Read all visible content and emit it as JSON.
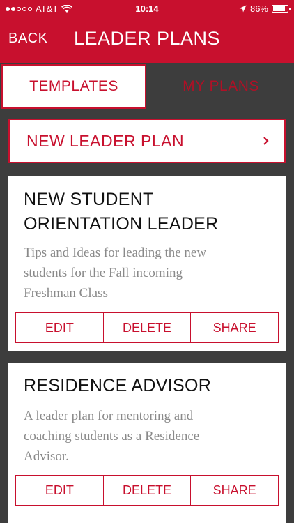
{
  "status_bar": {
    "carrier": "AT&T",
    "time": "10:14",
    "battery": "86%",
    "battery_level": 0.86,
    "icons": [
      "signal-dots",
      "wifi-icon",
      "location-arrow-icon",
      "battery-icon"
    ]
  },
  "header": {
    "back_label": "BACK",
    "title": "LEADER PLANS",
    "color": "#c8102e"
  },
  "tabs": [
    {
      "label": "TEMPLATES",
      "active": true
    },
    {
      "label": "MY PLANS",
      "active": false
    }
  ],
  "new_plan": {
    "label": "NEW LEADER PLAN",
    "icon": "chevron-right-icon"
  },
  "cards": [
    {
      "title_line1": "NEW STUDENT",
      "title_line2": "ORIENTATION LEADER",
      "desc_line1": "Tips and Ideas for leading the new",
      "desc_line2": "students for the Fall incoming",
      "desc_line3": "Freshman Class",
      "actions": {
        "edit": "EDIT",
        "delete": "DELETE",
        "share": "SHARE"
      }
    },
    {
      "title_line1": "RESIDENCE ADVISOR",
      "desc_line1": "A leader plan for mentoring and",
      "desc_line2": "coaching students as a Residence",
      "desc_line3": "Advisor.",
      "actions": {
        "edit": "EDIT",
        "delete": "DELETE",
        "share": "SHARE"
      }
    }
  ]
}
